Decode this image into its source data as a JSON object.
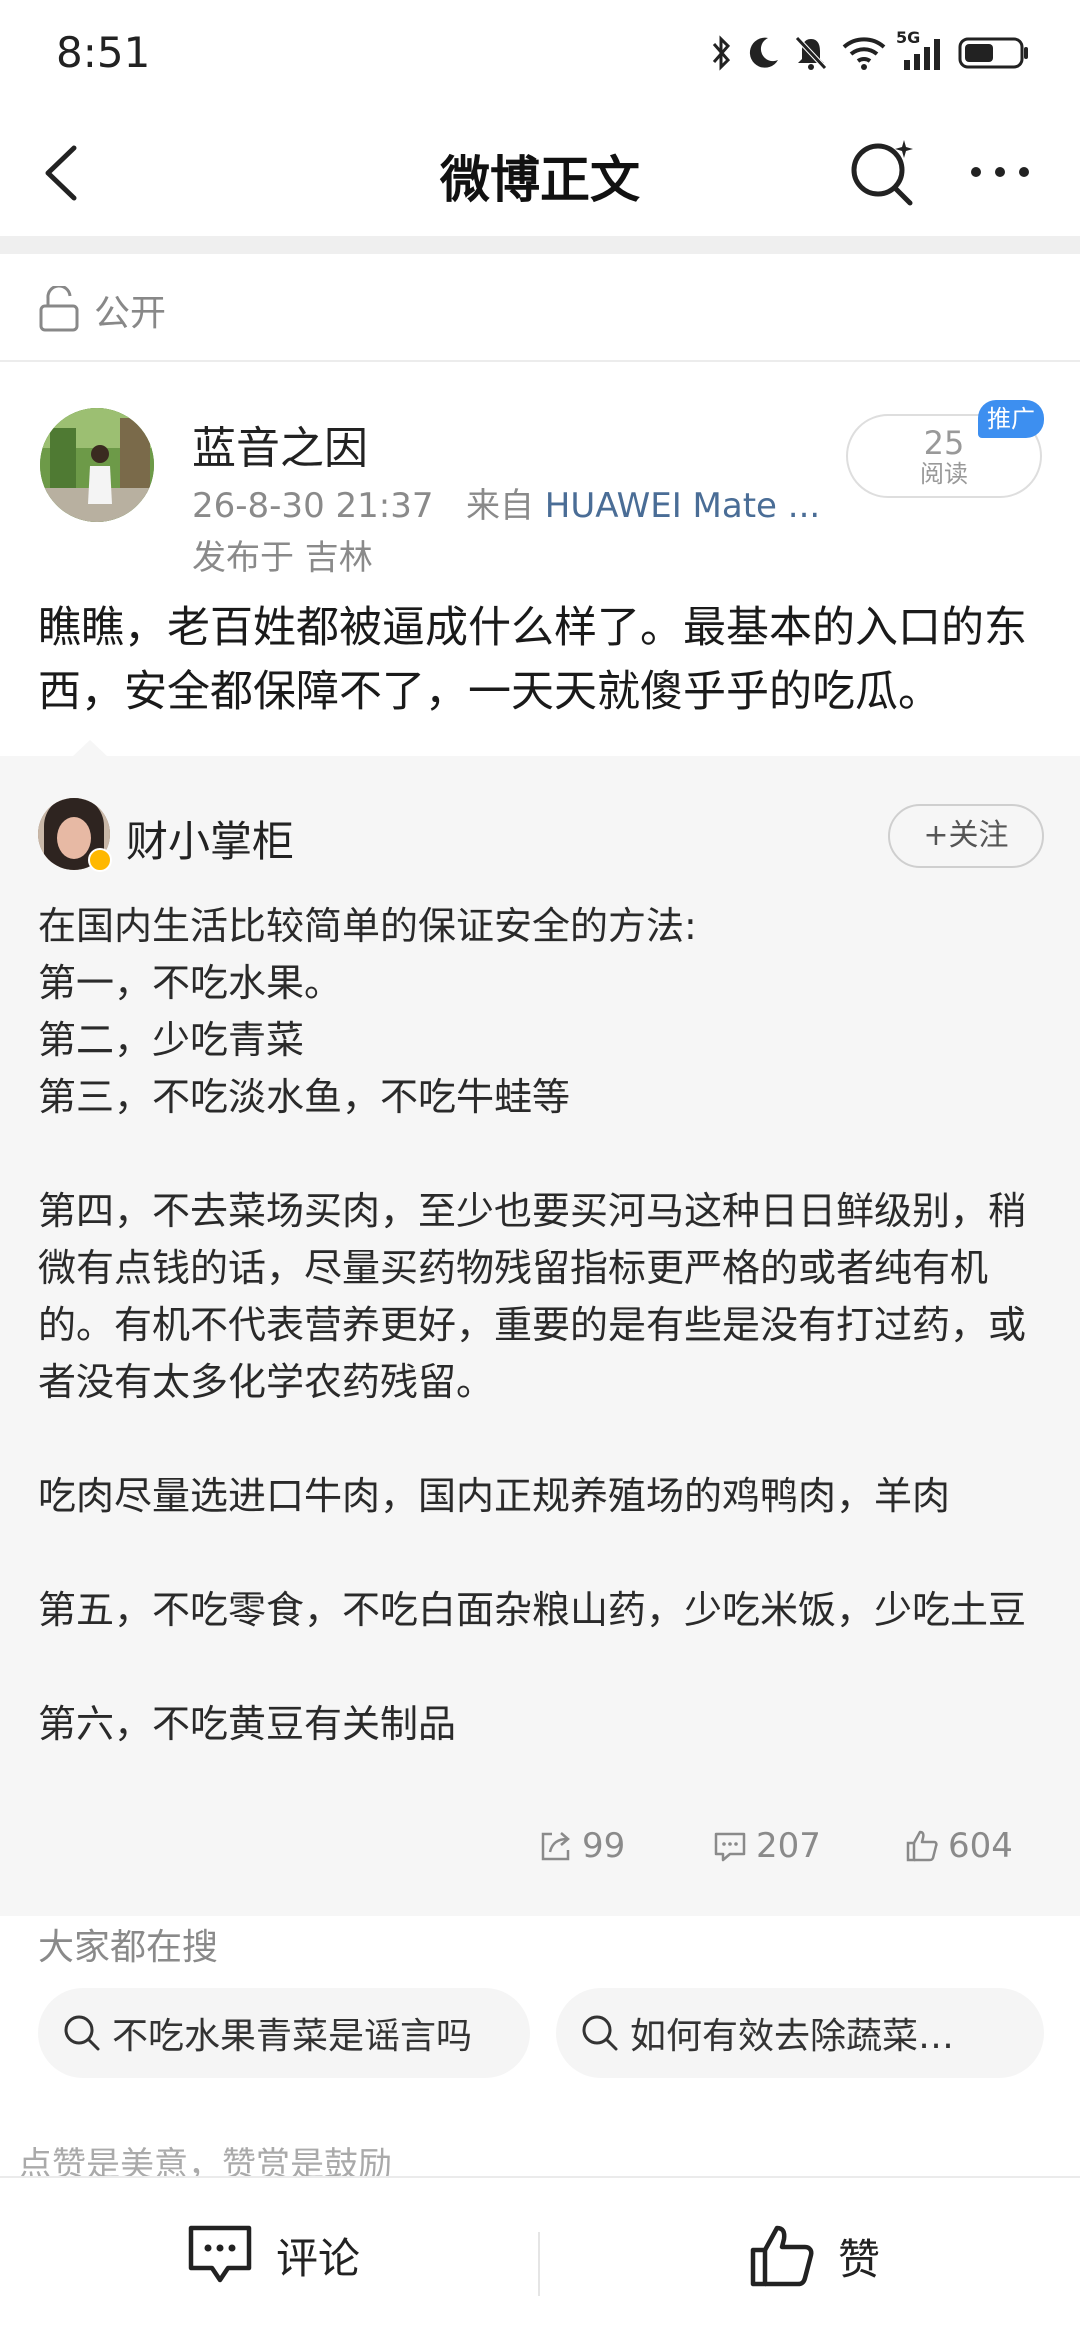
{
  "status_bar": {
    "time": "8:51",
    "network": "5G"
  },
  "nav": {
    "title": "微博正文"
  },
  "visibility": {
    "label": "公开"
  },
  "post": {
    "author": "蓝音之因",
    "time": "26-8-30 21:37",
    "source_prefix": "来自",
    "device": "HUAWEI Mate ...",
    "location": "发布于 吉林",
    "read_count": "25",
    "read_label": "阅读",
    "promo_tag": "推广",
    "text": "瞧瞧，老百姓都被逼成什么样了。最基本的入口的东西，安全都保障不了，一天天就傻乎乎的吃瓜。"
  },
  "repost": {
    "author": "财小掌柜",
    "follow_label": "+关注",
    "lines": [
      "在国内生活比较简单的保证安全的方法:",
      "第一，不吃水果。",
      "第二，少吃青菜",
      "第三，不吃淡水鱼，不吃牛蛙等",
      "",
      "第四，不去菜场买肉，至少也要买河马这种日日鲜级别，稍微有点钱的话，尽量买药物残留指标更严格的或者纯有机的。有机不代表营养更好，重要的是有些是没有打过药，或者没有太多化学农药残留。",
      "",
      "吃肉尽量选进口牛肉，国内正规养殖场的鸡鸭肉，羊肉",
      "",
      "第五，不吃零食，不吃白面杂粮山药，少吃米饭，少吃土豆",
      "",
      "第六，不吃黄豆有关制品"
    ],
    "reposts": "99",
    "comments": "207",
    "likes": "604"
  },
  "hot_search": {
    "title": "大家都在搜",
    "items": [
      "不吃水果青菜是谣言吗",
      "如何有效去除蔬菜…"
    ]
  },
  "encourage_text": "点赞是美意，赞赏是鼓励",
  "bottom_bar": {
    "comment_label": "评论",
    "like_label": "赞"
  },
  "colors": {
    "link": "#4a6d96",
    "promo": "#3d8ff0",
    "verified": "#ffb800"
  }
}
